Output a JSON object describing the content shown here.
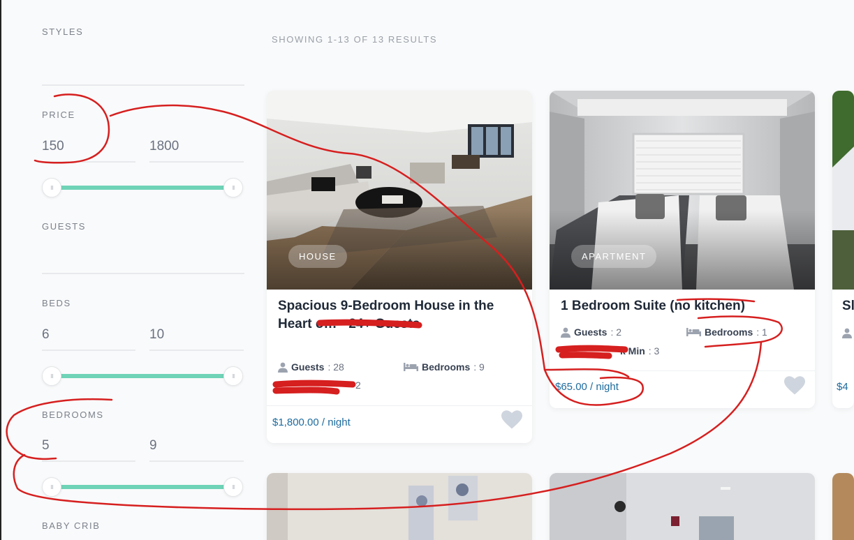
{
  "filters": {
    "styles_label": "STYLES",
    "price": {
      "label": "PRICE",
      "min": "150",
      "max": "1800"
    },
    "guests_label": "GUESTS",
    "beds": {
      "label": "BEDS",
      "min": "6",
      "max": "10"
    },
    "bedrooms": {
      "label": "BEDROOMS",
      "min": "5",
      "max": "9"
    },
    "baby_crib_label": "BABY CRIB",
    "slider_color": "#6fd3b7"
  },
  "results": {
    "count_text": "SHOWING 1-13 OF 13 RESULTS"
  },
  "listings": [
    {
      "type": "HOUSE",
      "title": "Spacious 9-Bedroom House in the Heart o… - 24+ Guests",
      "guests_label": "Guests",
      "guests_value": ": 28",
      "bedrooms_label": "Bedrooms",
      "bedrooms_value": ": 9",
      "extra_value": "2",
      "price": "$1,800.00 / night",
      "favorite_icon": "heart-icon"
    },
    {
      "type": "APARTMENT",
      "title": "1 Bedroom Suite (no kitchen)",
      "guests_label": "Guests",
      "guests_value": ": 2",
      "bedrooms_label": "Bedrooms",
      "bedrooms_value": ": 1",
      "extra_label": "k Min",
      "extra_value": ": 3",
      "price": "$65.00 / night",
      "favorite_icon": "heart-icon"
    }
  ],
  "partial_listing": {
    "title_fragment": "Sl",
    "price_fragment": "$4"
  },
  "colors": {
    "price": "#1e6b9e",
    "annotation": "#d61f1f",
    "heart": "#cfd5de"
  }
}
